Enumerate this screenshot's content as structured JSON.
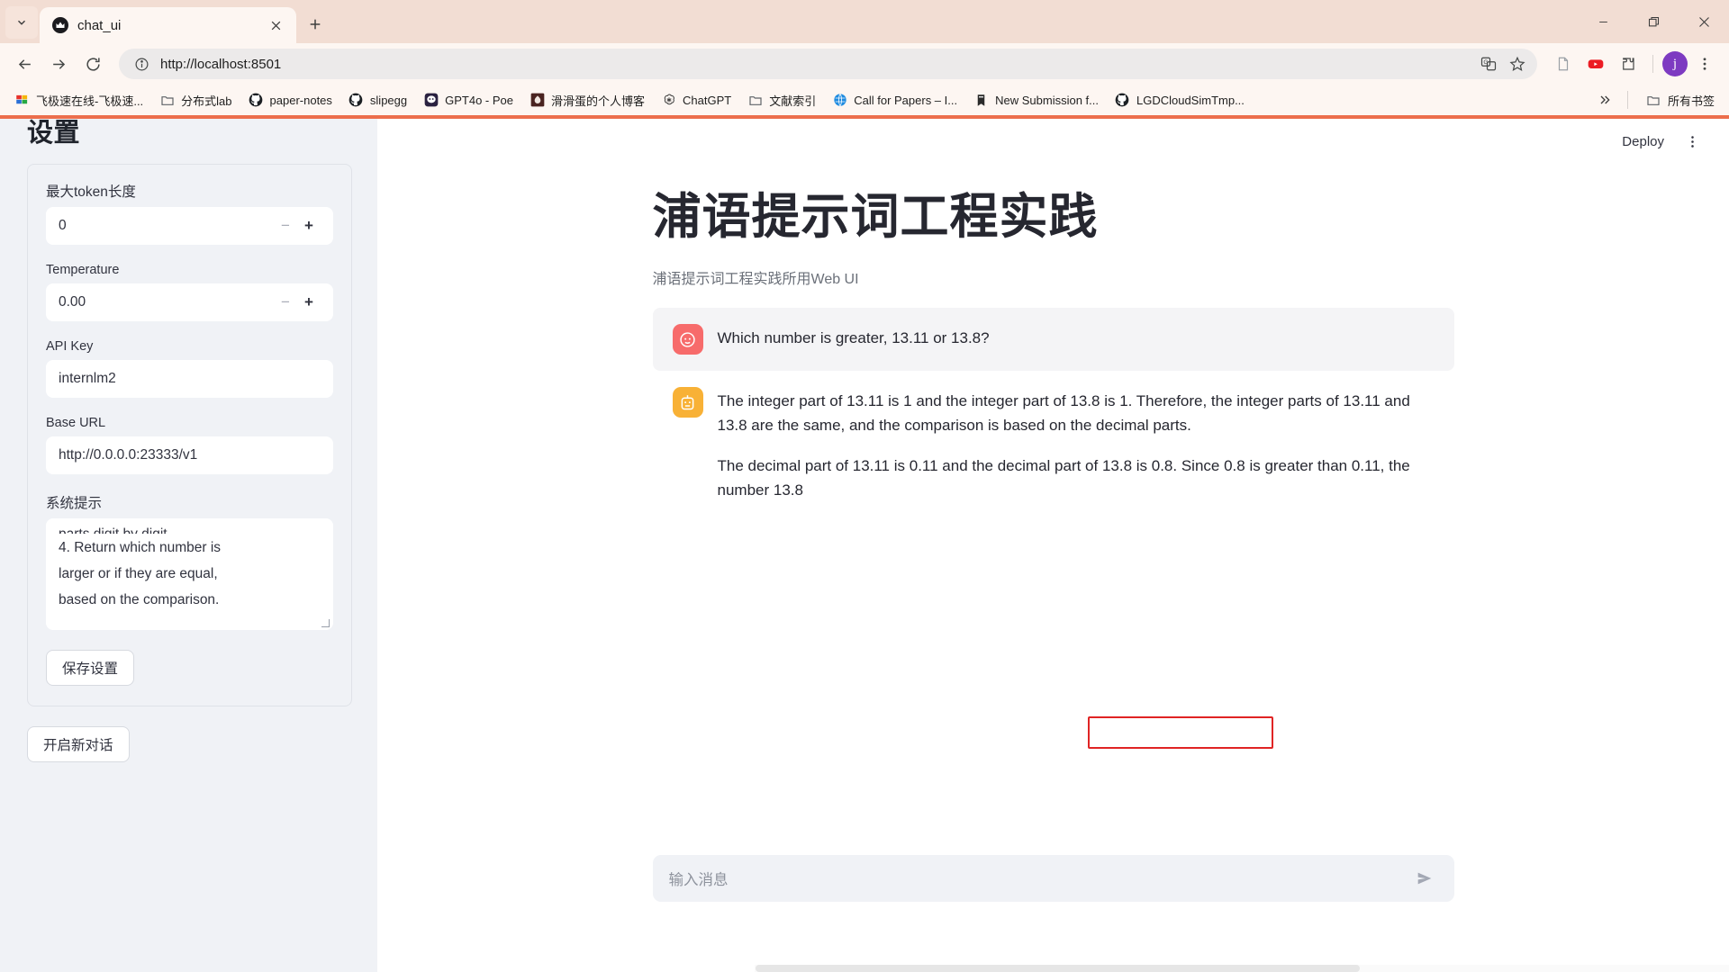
{
  "browser": {
    "tab": {
      "title": "chat_ui",
      "favicon_icon": "crown-icon",
      "close_icon": "close-icon"
    },
    "tab_list_icon": "chevron-down-icon",
    "new_tab_icon": "plus-icon",
    "window_controls": {
      "minimize": "minimize-icon",
      "maximize": "maximize-icon",
      "close": "close-icon"
    },
    "nav": {
      "back_icon": "back-arrow-icon",
      "forward_icon": "forward-arrow-icon",
      "reload_icon": "reload-icon"
    },
    "omnibox": {
      "info_icon": "site-info-icon",
      "url": "http://localhost:8501",
      "translate_icon": "translate-icon",
      "bookmark_icon": "star-icon"
    },
    "toolbar_right": {
      "reading_list_icon": "document-icon",
      "youtube_icon": "youtube-icon",
      "extensions_icon": "puzzle-icon",
      "profile_initial": "j",
      "menu_icon": "three-dot-menu-icon"
    },
    "bookmarks": [
      {
        "label": "飞极速在线-飞极速...",
        "icon": "zfile-icon"
      },
      {
        "label": "分布式lab",
        "icon": "folder-icon"
      },
      {
        "label": "paper-notes",
        "icon": "github-icon"
      },
      {
        "label": "slipegg",
        "icon": "github-icon"
      },
      {
        "label": "GPT4o - Poe",
        "icon": "poe-icon"
      },
      {
        "label": "滑滑蛋的个人博客",
        "icon": "blog-icon"
      },
      {
        "label": "ChatGPT",
        "icon": "openai-icon"
      },
      {
        "label": "文献索引",
        "icon": "folder-icon"
      },
      {
        "label": "Call for Papers – I...",
        "icon": "globe-icon"
      },
      {
        "label": "New Submission f...",
        "icon": "book-icon"
      },
      {
        "label": "LGDCloudSimTmp...",
        "icon": "github-icon"
      }
    ],
    "bookmarks_overflow_icon": "chevron-double-right-icon",
    "all_bookmarks": {
      "label": "所有书签",
      "icon": "folder-icon"
    }
  },
  "sidebar": {
    "title": "设置",
    "fields": {
      "max_token": {
        "label": "最大token长度",
        "value": "0",
        "minus": "−",
        "plus": "+"
      },
      "temperature": {
        "label": "Temperature",
        "value": "0.00",
        "minus": "−",
        "plus": "+"
      },
      "api_key": {
        "label": "API Key",
        "value": "internlm2"
      },
      "base_url": {
        "label": "Base URL",
        "value": "http://0.0.0.0:23333/v1"
      },
      "system_prompt": {
        "label": "系统提示",
        "visible_lines": [
          "parts digit by digit.",
          "4. Return which number is",
          "larger or if they are equal,",
          "based on the comparison."
        ]
      }
    },
    "save_button": "保存设置",
    "new_chat_button": "开启新对话"
  },
  "main": {
    "deploy_button": "Deploy",
    "kebab_icon": "three-dot-menu-icon",
    "title": "浦语提示词工程实践",
    "subtitle": "浦语提示词工程实践所用Web UI",
    "messages": [
      {
        "role": "user",
        "avatar_icon": "user-face-icon",
        "avatar_color": "#f76b6b",
        "paragraphs": [
          "Which number is greater, 13.11 or 13.8?"
        ]
      },
      {
        "role": "assistant",
        "avatar_icon": "robot-icon",
        "avatar_color": "#f8b136",
        "paragraphs": [
          "The integer part of 13.11 is 1 and the integer part of 13.8 is 1. Therefore, the integer parts of 13.11 and 13.8 are the same, and the comparison is based on the decimal parts.",
          "The decimal part of 13.11 is 0.11 and the decimal part of 13.8 is 0.8. Since 0.8 is greater than 0.11, the number 13.8"
        ]
      }
    ],
    "annotation": {
      "color": "#e02424",
      "target_text": "the number 13.8"
    },
    "composer": {
      "placeholder": "输入消息",
      "send_icon": "send-arrow-icon"
    }
  },
  "colors": {
    "browser_chrome": "#f2ddd3",
    "toolbar": "#fdf6f2",
    "accent_top": "#ec6e4c",
    "sidebar_bg": "#f0f2f6",
    "user_bubble": "#f4f4f6"
  }
}
